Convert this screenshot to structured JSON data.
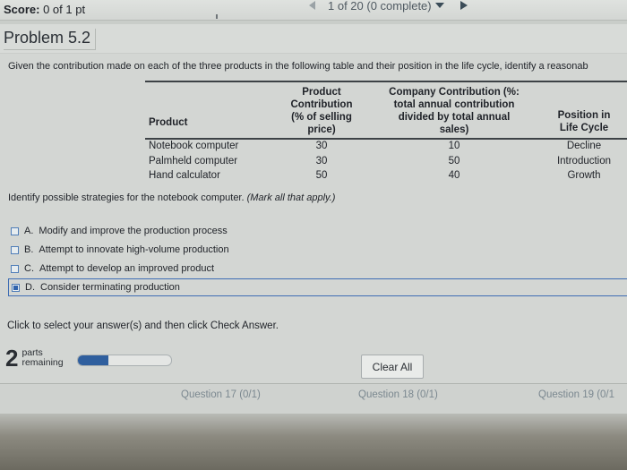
{
  "topbar": {
    "score_label": "Score:",
    "score_value": "0 of 1 pt",
    "pager_text": "1 of 20 (0 complete)"
  },
  "problem": {
    "title": "Problem 5.2"
  },
  "intro_text": "Given the contribution made on each of the three products in the following table and their position in the life cycle, identify a reasonab",
  "table": {
    "headers": {
      "product": "Product",
      "contribution": "Product Contribution (% of selling price)",
      "company": "Company Contribution (%: total annual contribution divided by total annual sales)",
      "position": "Position in Life Cycle"
    },
    "rows": [
      {
        "product": "Notebook computer",
        "contribution": "30",
        "company": "10",
        "position": "Decline"
      },
      {
        "product": "Palmheld computer",
        "contribution": "30",
        "company": "50",
        "position": "Introduction"
      },
      {
        "product": "Hand calculator",
        "contribution": "50",
        "company": "40",
        "position": "Growth"
      }
    ]
  },
  "question": {
    "prompt": "Identify possible strategies for the notebook computer.",
    "instruction": "(Mark all that apply.)"
  },
  "options": [
    {
      "letter": "A.",
      "text": "Modify and improve the production process",
      "checked": false
    },
    {
      "letter": "B.",
      "text": "Attempt to innovate high-volume production",
      "checked": false
    },
    {
      "letter": "C.",
      "text": "Attempt to develop an improved product",
      "checked": false
    },
    {
      "letter": "D.",
      "text": "Consider terminating production",
      "checked": true
    }
  ],
  "hint": "Click to select your answer(s) and then click Check Answer.",
  "parts": {
    "count": "2",
    "label_line1": "parts",
    "label_line2": "remaining",
    "progress": 0.33
  },
  "buttons": {
    "clear_all": "Clear All"
  },
  "question_nav": [
    "Question 17 (0/1)",
    "Question 18 (0/1)",
    "Question 19 (0/1"
  ],
  "colors": {
    "accent": "#2f5f9e",
    "checkbox_border": "#4f7db8"
  }
}
